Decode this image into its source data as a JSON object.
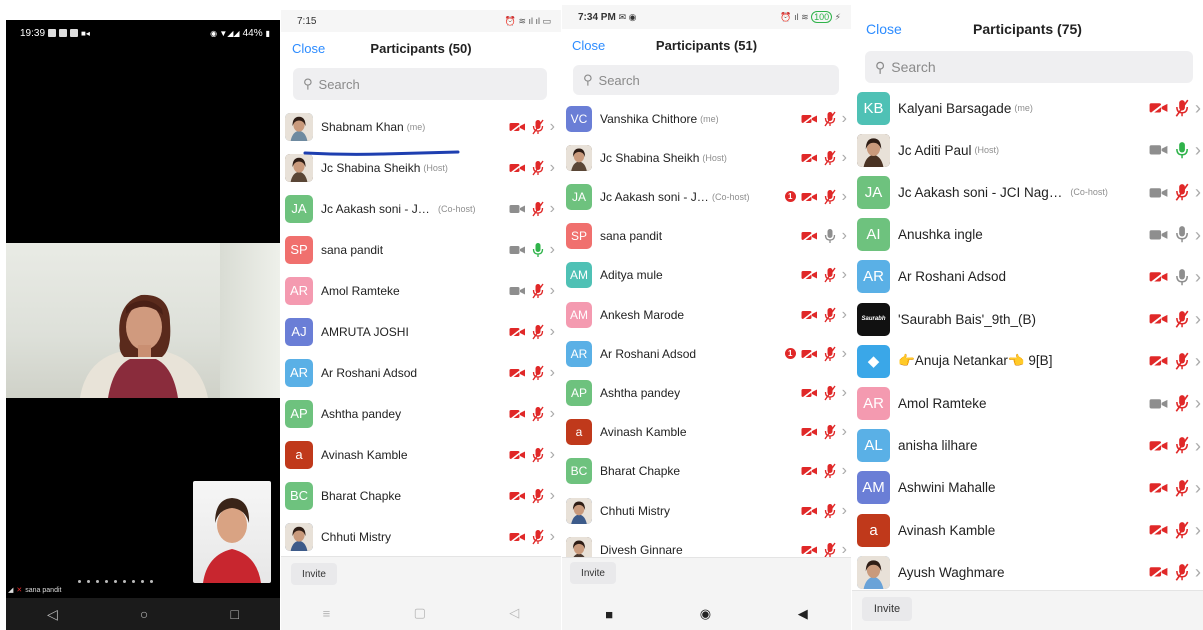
{
  "panel1": {
    "time": "19:39",
    "battery": "44%",
    "speaker_name": "sana pandit"
  },
  "panel2": {
    "status_time": "7:15",
    "close": "Close",
    "title": "Participants (50)",
    "search_placeholder": "Search",
    "invite": "Invite",
    "participants": [
      {
        "name": "Shabnam Khan",
        "tag": "(me)",
        "initials": "",
        "avatar_color": "#6e8aa0",
        "photo": true,
        "video": "off",
        "mic": "off"
      },
      {
        "name": "Jc Shabina Sheikh",
        "tag": "(Host)",
        "initials": "",
        "avatar_color": "#5a4636",
        "photo": true,
        "video": "off",
        "mic": "off"
      },
      {
        "name": "Jc Aakash soni - JCI...",
        "tag": "(Co-host)",
        "initials": "JA",
        "avatar_color": "#6ec27e",
        "video": "on",
        "mic": "off"
      },
      {
        "name": "sana pandit",
        "tag": "",
        "initials": "SP",
        "avatar_color": "#f0706e",
        "video": "on",
        "mic": "on"
      },
      {
        "name": "Amol Ramteke",
        "tag": "",
        "initials": "AR",
        "avatar_color": "#f49ab0",
        "video": "on",
        "mic": "off"
      },
      {
        "name": "AMRUTA JOSHI",
        "tag": "",
        "initials": "AJ",
        "avatar_color": "#6a7ed6",
        "video": "off",
        "mic": "off"
      },
      {
        "name": "Ar Roshani Adsod",
        "tag": "",
        "initials": "AR",
        "avatar_color": "#5ab0e6",
        "video": "off",
        "mic": "off"
      },
      {
        "name": "Ashtha pandey",
        "tag": "",
        "initials": "AP",
        "avatar_color": "#6ec27e",
        "video": "off",
        "mic": "off"
      },
      {
        "name": "Avinash Kamble",
        "tag": "",
        "initials": "a",
        "avatar_color": "#c0391b",
        "video": "off",
        "mic": "off"
      },
      {
        "name": "Bharat Chapke",
        "tag": "",
        "initials": "BC",
        "avatar_color": "#6ec27e",
        "video": "off",
        "mic": "off"
      },
      {
        "name": "Chhuti Mistry",
        "tag": "",
        "initials": "",
        "avatar_color": "#3d5b8a",
        "photo": true,
        "video": "off",
        "mic": "off"
      }
    ]
  },
  "panel3": {
    "status_time": "7:34 PM",
    "battery": "100",
    "close": "Close",
    "title": "Participants (51)",
    "search_placeholder": "Search",
    "invite": "Invite",
    "participants": [
      {
        "name": "Vanshika Chithore",
        "tag": "(me)",
        "initials": "VC",
        "avatar_color": "#6a7ed6",
        "video": "off",
        "mic": "off"
      },
      {
        "name": "Jc Shabina Sheikh",
        "tag": "(Host)",
        "initials": "",
        "avatar_color": "#5a4636",
        "photo": true,
        "video": "off",
        "mic": "off"
      },
      {
        "name": "Jc Aakash soni - JCI N...",
        "tag": "(Co-host)",
        "initials": "JA",
        "avatar_color": "#6ec27e",
        "badge": "1",
        "video": "off",
        "mic": "off"
      },
      {
        "name": "sana pandit",
        "tag": "",
        "initials": "SP",
        "avatar_color": "#f0706e",
        "video": "off",
        "mic": "mute-grey"
      },
      {
        "name": "Aditya mule",
        "tag": "",
        "initials": "AM",
        "avatar_color": "#4fc1b5",
        "video": "off",
        "mic": "off"
      },
      {
        "name": "Ankesh Marode",
        "tag": "",
        "initials": "AM",
        "avatar_color": "#f49ab0",
        "video": "off",
        "mic": "off"
      },
      {
        "name": "Ar Roshani Adsod",
        "tag": "",
        "initials": "AR",
        "avatar_color": "#5ab0e6",
        "badge": "1",
        "video": "off",
        "mic": "off"
      },
      {
        "name": "Ashtha pandey",
        "tag": "",
        "initials": "AP",
        "avatar_color": "#6ec27e",
        "video": "off",
        "mic": "off"
      },
      {
        "name": "Avinash Kamble",
        "tag": "",
        "initials": "a",
        "avatar_color": "#c0391b",
        "video": "off",
        "mic": "off"
      },
      {
        "name": "Bharat Chapke",
        "tag": "",
        "initials": "BC",
        "avatar_color": "#6ec27e",
        "video": "off",
        "mic": "off"
      },
      {
        "name": "Chhuti Mistry",
        "tag": "",
        "initials": "",
        "avatar_color": "#3d5b8a",
        "photo": true,
        "video": "off",
        "mic": "off"
      },
      {
        "name": "Divesh Ginnare",
        "tag": "",
        "initials": "",
        "avatar_color": "#4a3a30",
        "photo": true,
        "video": "off",
        "mic": "off"
      }
    ]
  },
  "panel4": {
    "close": "Close",
    "title": "Participants (75)",
    "search_placeholder": "Search",
    "invite": "Invite",
    "participants": [
      {
        "name": "Kalyani Barsagade",
        "tag": "(me)",
        "initials": "KB",
        "avatar_color": "#4fc1b5",
        "video": "off",
        "mic": "off"
      },
      {
        "name": "Jc Aditi Paul",
        "tag": "(Host)",
        "initials": "",
        "avatar_color": "#4a3324",
        "photo": true,
        "video": "on",
        "mic": "on"
      },
      {
        "name": "Jc Aakash soni - JCI Nagp...",
        "tag": "(Co-host)",
        "initials": "JA",
        "avatar_color": "#6ec27e",
        "video": "on",
        "mic": "off"
      },
      {
        "name": "Anushka ingle",
        "tag": "",
        "initials": "AI",
        "avatar_color": "#6ec27e",
        "video": "on",
        "mic": "mute-grey"
      },
      {
        "name": "Ar Roshani Adsod",
        "tag": "",
        "initials": "AR",
        "avatar_color": "#5ab0e6",
        "video": "off",
        "mic": "mute-grey"
      },
      {
        "name": "'Saurabh Bais'_9th_(B)",
        "tag": "",
        "initials": "Saurabh",
        "avatar_color": "#111111",
        "logo": true,
        "video": "off",
        "mic": "off"
      },
      {
        "name": "👉Anuja Netankar👈 9[B]",
        "tag": "",
        "initials": "◆",
        "avatar_color": "#3aa7e8",
        "video": "off",
        "mic": "off"
      },
      {
        "name": "Amol Ramteke",
        "tag": "",
        "initials": "AR",
        "avatar_color": "#f49ab0",
        "video": "on",
        "mic": "off"
      },
      {
        "name": "anisha lilhare",
        "tag": "",
        "initials": "AL",
        "avatar_color": "#5ab0e6",
        "video": "off",
        "mic": "off"
      },
      {
        "name": "Ashwini Mahalle",
        "tag": "",
        "initials": "AM",
        "avatar_color": "#6a7ed6",
        "video": "off",
        "mic": "off"
      },
      {
        "name": "Avinash Kamble",
        "tag": "",
        "initials": "a",
        "avatar_color": "#c0391b",
        "video": "off",
        "mic": "off"
      },
      {
        "name": "Ayush Waghmare",
        "tag": "",
        "initials": "",
        "avatar_color": "#6aa3d8",
        "photo": true,
        "video": "off",
        "mic": "off"
      }
    ]
  },
  "colors": {
    "accent": "#2d8cff",
    "muted_red": "#e02828",
    "mic_on": "#2fb34a",
    "icon_grey": "#8e8e8e"
  }
}
